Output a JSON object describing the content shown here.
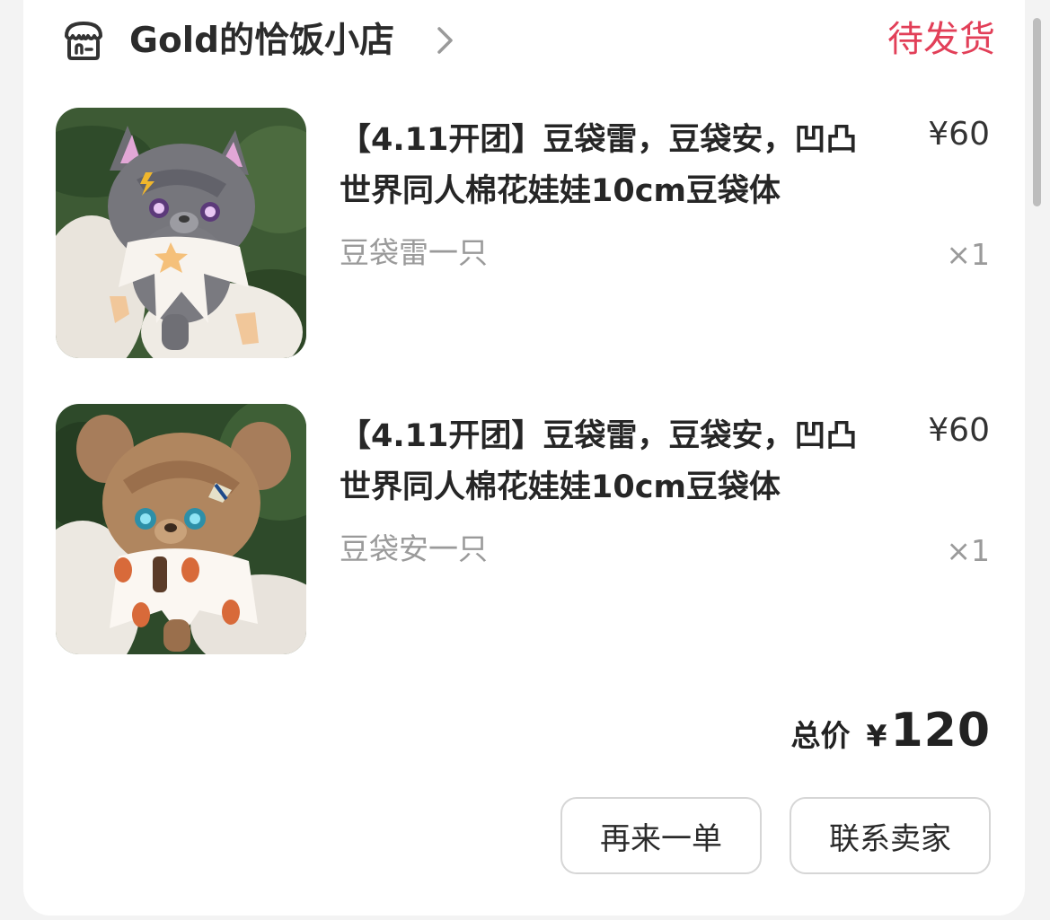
{
  "shop": {
    "name": "Gold的恰饭小店",
    "icon": "shop-icon",
    "status": "待发货",
    "status_color": "#e23f58"
  },
  "items": [
    {
      "title": "【4.11开团】豆袋雷，豆袋安，凹凸世界同人棉花娃娃10cm豆袋体",
      "price": "¥60",
      "variant": "豆袋雷一只",
      "quantity": "×1",
      "image": "gray-cat-plush-doll"
    },
    {
      "title": "【4.11开团】豆袋雷，豆袋安，凹凸世界同人棉花娃娃10cm豆袋体",
      "price": "¥60",
      "variant": "豆袋安一只",
      "quantity": "×1",
      "image": "brown-bear-plush-doll"
    }
  ],
  "summary": {
    "label": "总价",
    "currency": "¥",
    "amount": "120"
  },
  "actions": {
    "reorder": "再来一单",
    "contact_seller": "联系卖家"
  }
}
